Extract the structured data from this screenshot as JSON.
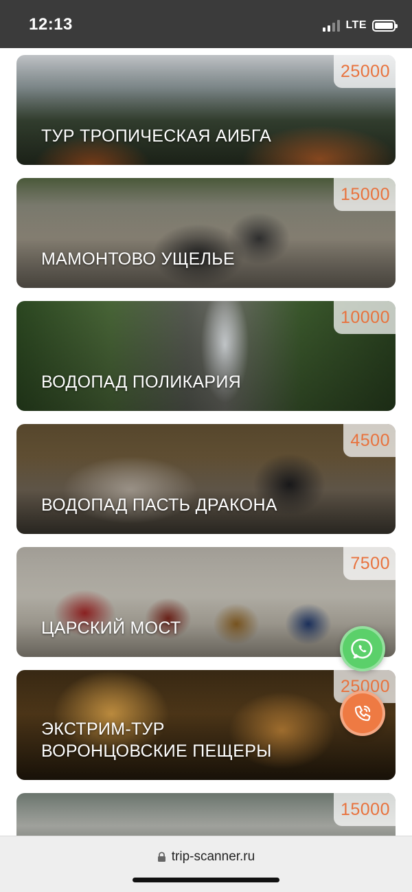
{
  "status_bar": {
    "time": "12:13",
    "network": "LTE",
    "icons": [
      "signal-icon",
      "battery-icon"
    ]
  },
  "tours": [
    {
      "title": "Тур Тропическая Аибга",
      "price": "25000"
    },
    {
      "title": "Мамонтово ущелье",
      "price": "15000"
    },
    {
      "title": "Водопад Поликария",
      "price": "10000"
    },
    {
      "title": "Водопад Пасть Дракона",
      "price": "4500"
    },
    {
      "title": "Царский мост",
      "price": "7500"
    },
    {
      "title_line1": "Экстрим-тур",
      "title_line2": "Воронцовские пещеры",
      "price": "25000"
    },
    {
      "title": "",
      "price": "15000"
    }
  ],
  "colors": {
    "price_text": "#e8723d",
    "whatsapp_button": "#5bd06a",
    "phone_button": "#ee7a43",
    "status_bar_bg": "#3b3b3b"
  },
  "floating_buttons": {
    "whatsapp_icon": "whatsapp-icon",
    "phone_icon": "phone-icon"
  },
  "browser": {
    "url": "trip-scanner.ru",
    "secure_icon": "lock-icon"
  }
}
